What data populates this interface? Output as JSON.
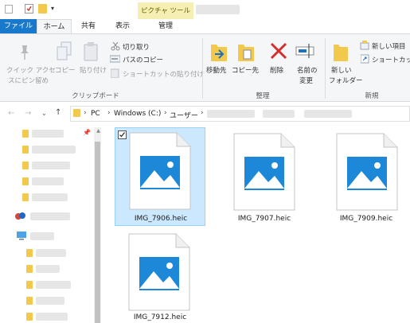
{
  "title_bar": {
    "context_tab": "ピクチャ ツール"
  },
  "tabs": [
    {
      "label": "ファイル"
    },
    {
      "label": "ホーム"
    },
    {
      "label": "共有"
    },
    {
      "label": "表示"
    },
    {
      "label": "管理"
    }
  ],
  "ribbon": {
    "clipboard": {
      "pin_label_1": "クイック アクセ",
      "pin_label_2": "スにピン留め",
      "copy": "コピー",
      "paste": "貼り付け",
      "cut": "切り取り",
      "copy_path": "パスのコピー",
      "paste_shortcut": "ショートカットの貼り付け",
      "group": "クリップボード"
    },
    "organize": {
      "move_to": "移動先",
      "copy_to": "コピー先",
      "delete": "削除",
      "rename_1": "名前の",
      "rename_2": "変更",
      "group": "整理"
    },
    "new": {
      "new_folder_1": "新しい",
      "new_folder_2": "フォルダー",
      "new_item": "新しい項目",
      "shortcut": "ショートカット",
      "group": "新規"
    }
  },
  "address": {
    "crumbs": [
      "PC",
      "Windows (C:)",
      "ユーザー"
    ]
  },
  "files": [
    {
      "name": "IMG_7906.heic",
      "selected": true
    },
    {
      "name": "IMG_7907.heic",
      "selected": false
    },
    {
      "name": "IMG_7909.heic",
      "selected": false
    },
    {
      "name": "IMG_7912.heic",
      "selected": false
    }
  ],
  "colors": {
    "accent": "#1979ca",
    "selection": "#cce8ff",
    "context_tab": "#f6efb3",
    "icon_blue": "#1e88d8"
  }
}
